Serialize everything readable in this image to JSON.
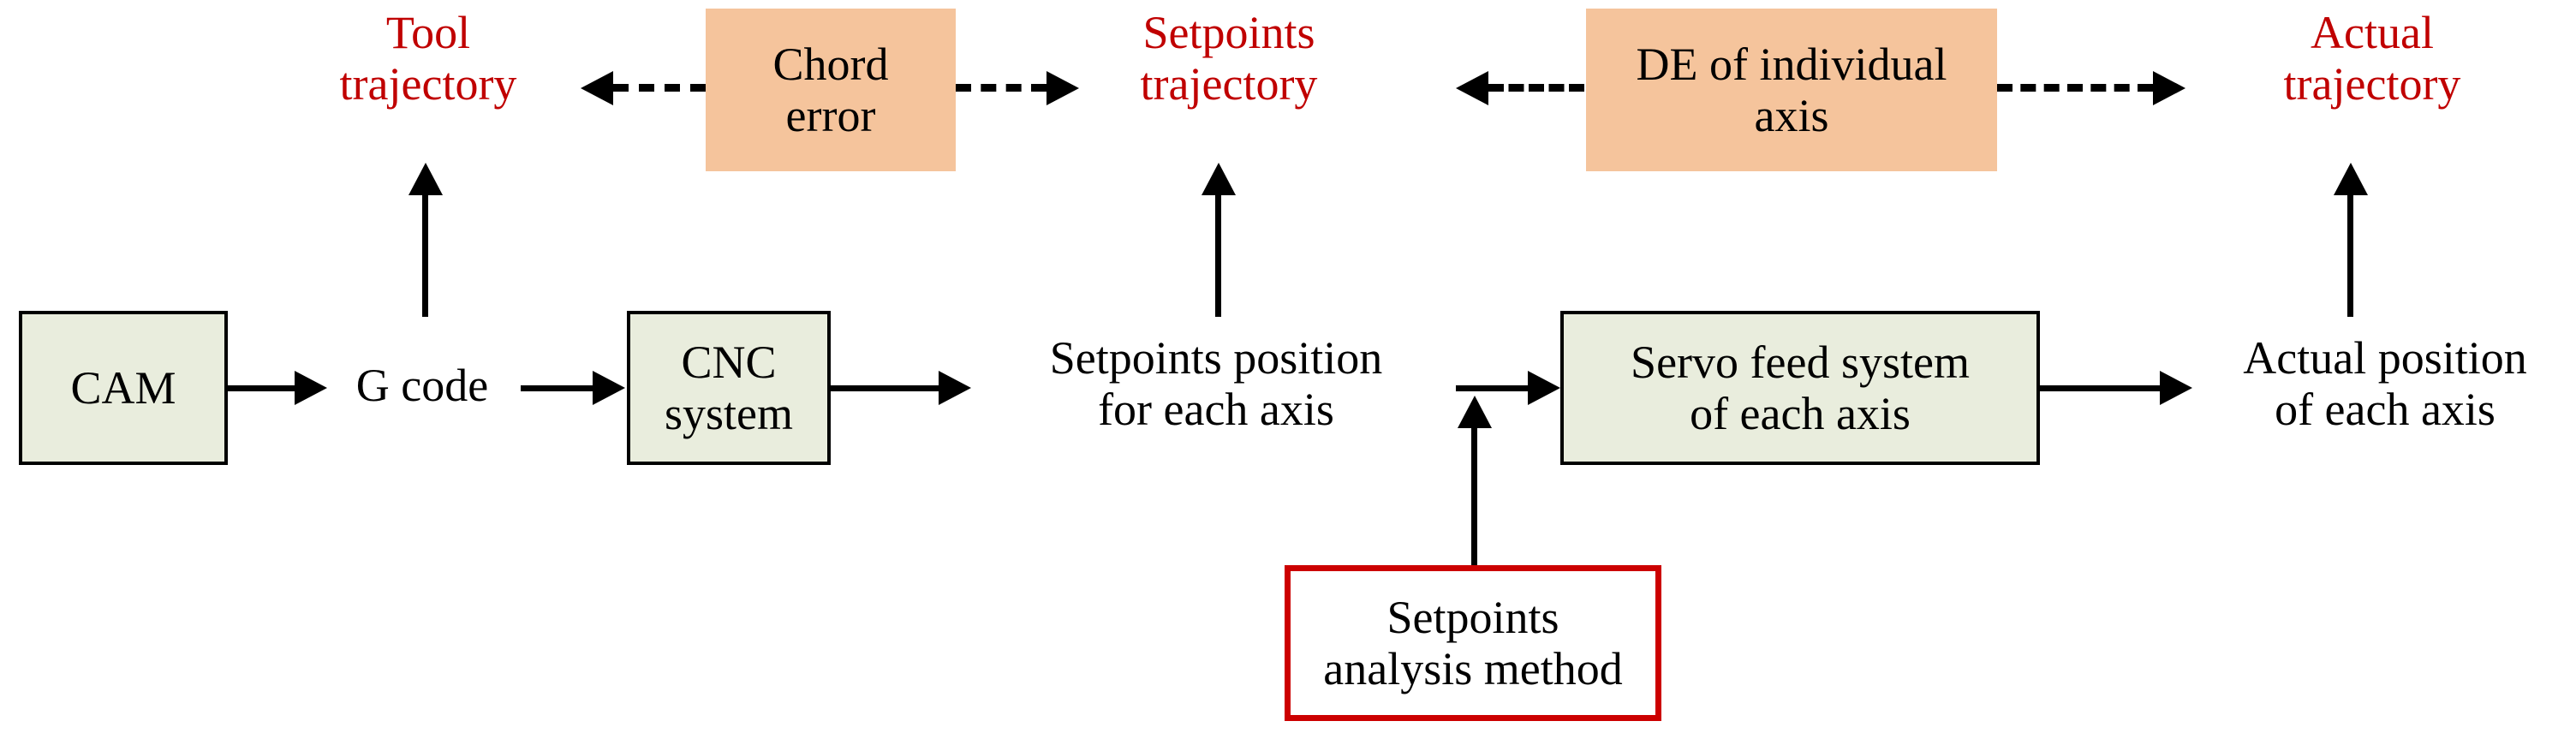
{
  "diagram": {
    "title_colors": {
      "accent_red": "#C00000",
      "box_green": "#E9EDDD",
      "box_peach": "#F5C49C",
      "box_red_border": "#CC0000",
      "line_black": "#000000"
    },
    "top_row": {
      "tool_trajectory": "Tool\ntrajectory",
      "chord_error": "Chord\nerror",
      "setpoints_trajectory": "Setpoints\ntrajectory",
      "de_individual_axis": "DE of individual\naxis",
      "actual_trajectory": "Actual\ntrajectory"
    },
    "main_row": {
      "cam": "CAM",
      "g_code": "G code",
      "cnc_system": "CNC\nsystem",
      "setpoints_position": "Setpoints position\nfor each axis",
      "servo_feed_system": "Servo feed system\nof each axis",
      "actual_position": "Actual position\nof each axis"
    },
    "bottom_row": {
      "setpoints_analysis_method": "Setpoints\nanalysis method"
    }
  }
}
